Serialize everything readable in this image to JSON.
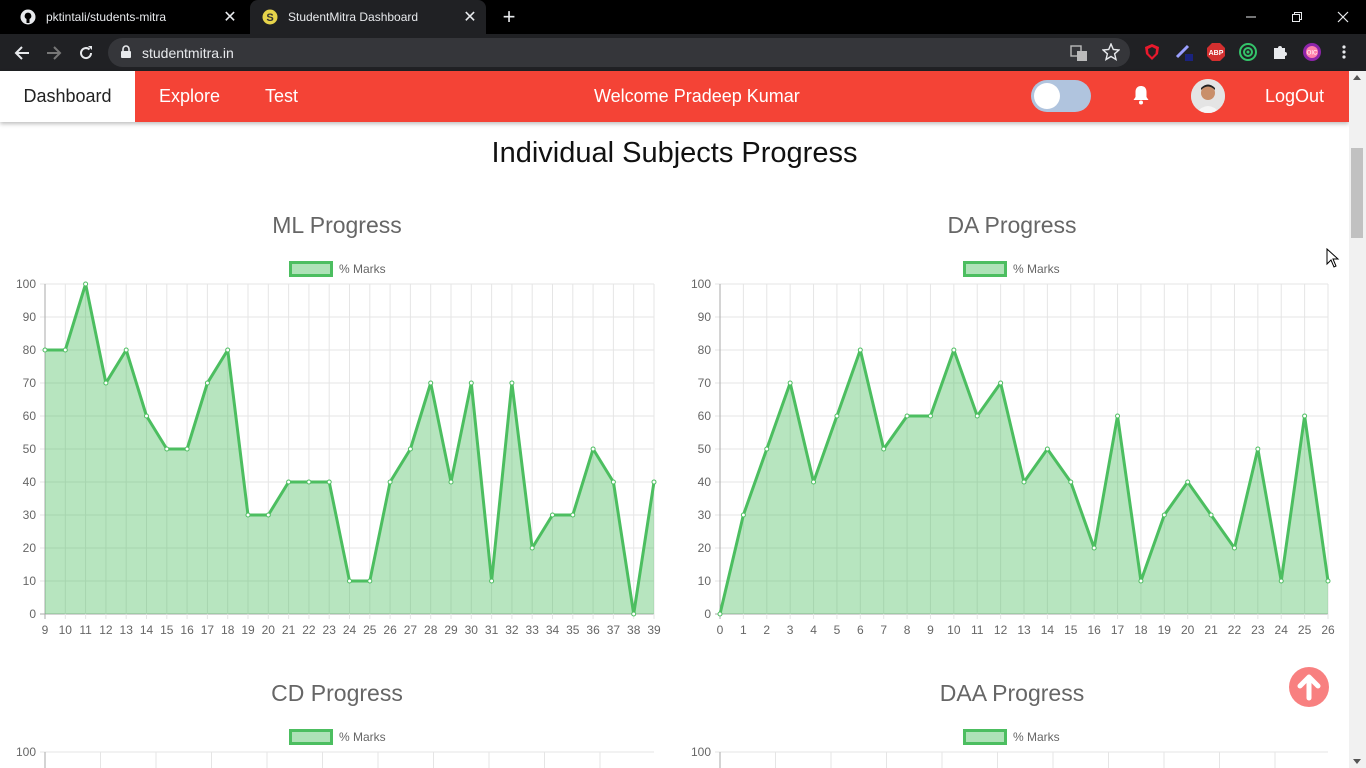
{
  "browser": {
    "tabs": [
      {
        "title": "pktintali/students-mitra",
        "icon": "github-icon",
        "active": false
      },
      {
        "title": "StudentMitra Dashboard",
        "icon": "studentmitra-favicon",
        "active": true
      }
    ],
    "url": "studentmitra.in"
  },
  "navbar": {
    "dashboard": "Dashboard",
    "explore": "Explore",
    "test": "Test",
    "welcome": "Welcome Pradeep Kumar",
    "logout": "LogOut",
    "color": "#f44336"
  },
  "page": {
    "title": "Individual Subjects Progress"
  },
  "charts": {
    "ml": {
      "title": "ML Progress",
      "legend": "% Marks"
    },
    "da": {
      "title": "DA Progress",
      "legend": "% Marks"
    },
    "cd": {
      "title": "CD Progress",
      "legend": "% Marks"
    },
    "daa": {
      "title": "DAA Progress",
      "legend": "% Marks"
    }
  },
  "chart_data": [
    {
      "type": "area",
      "title": "ML Progress",
      "series": [
        {
          "name": "% Marks",
          "values": [
            80,
            80,
            100,
            70,
            80,
            60,
            50,
            50,
            70,
            80,
            30,
            30,
            40,
            40,
            40,
            10,
            10,
            40,
            50,
            70,
            40,
            70,
            10,
            70,
            20,
            30,
            30,
            50,
            40,
            0,
            40
          ]
        }
      ],
      "x": [
        "9",
        "10",
        "11",
        "12",
        "13",
        "14",
        "15",
        "16",
        "17",
        "18",
        "19",
        "20",
        "21",
        "22",
        "23",
        "24",
        "25",
        "26",
        "27",
        "28",
        "29",
        "30",
        "31",
        "32",
        "33",
        "34",
        "35",
        "36",
        "37",
        "38",
        "39"
      ],
      "ylim": [
        0,
        100
      ],
      "yticks": [
        "0",
        "10",
        "20",
        "30",
        "40",
        "50",
        "60",
        "70",
        "80",
        "90",
        "100"
      ],
      "grid": true,
      "legend_position": "top",
      "color": "#4cbe60"
    },
    {
      "type": "area",
      "title": "DA Progress",
      "series": [
        {
          "name": "% Marks",
          "values": [
            0,
            30,
            50,
            70,
            40,
            60,
            80,
            50,
            60,
            60,
            80,
            60,
            70,
            40,
            50,
            40,
            20,
            60,
            10,
            30,
            40,
            30,
            20,
            50,
            10,
            60,
            10
          ]
        }
      ],
      "x": [
        "0",
        "1",
        "2",
        "3",
        "4",
        "5",
        "6",
        "7",
        "8",
        "9",
        "10",
        "11",
        "12",
        "13",
        "14",
        "15",
        "16",
        "17",
        "18",
        "19",
        "20",
        "21",
        "22",
        "23",
        "24",
        "25",
        "26"
      ],
      "ylim": [
        0,
        100
      ],
      "yticks": [
        "0",
        "10",
        "20",
        "30",
        "40",
        "50",
        "60",
        "70",
        "80",
        "90",
        "100"
      ],
      "grid": true,
      "legend_position": "top",
      "color": "#4cbe60"
    },
    {
      "type": "area",
      "title": "CD Progress",
      "series": [
        {
          "name": "% Marks",
          "values": []
        }
      ],
      "x": [],
      "ylim": [
        0,
        100
      ],
      "yticks": [
        "100"
      ],
      "grid": true,
      "legend_position": "top",
      "color": "#4cbe60"
    },
    {
      "type": "area",
      "title": "DAA Progress",
      "series": [
        {
          "name": "% Marks",
          "values": []
        }
      ],
      "x": [],
      "ylim": [
        0,
        100
      ],
      "yticks": [
        "100"
      ],
      "grid": true,
      "legend_position": "top",
      "color": "#4cbe60"
    }
  ]
}
